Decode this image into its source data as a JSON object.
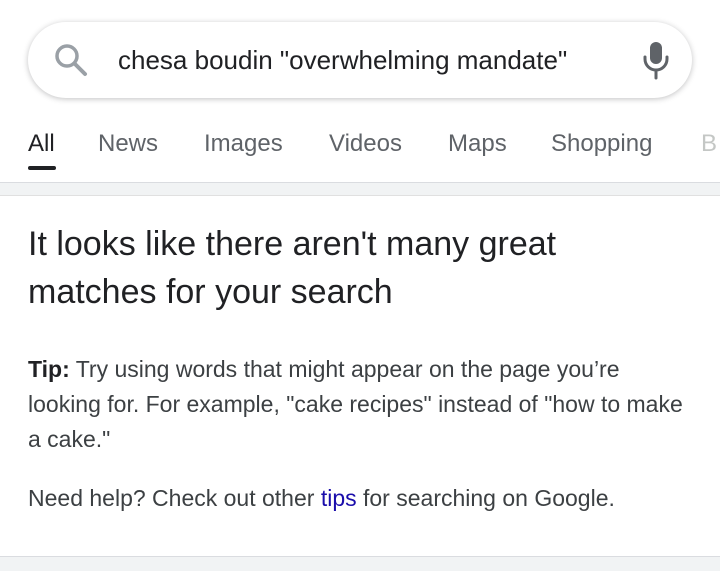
{
  "search": {
    "query": "chesa boudin \"overwhelming mandate\""
  },
  "tabs": [
    {
      "label": "All"
    },
    {
      "label": "News"
    },
    {
      "label": "Images"
    },
    {
      "label": "Videos"
    },
    {
      "label": "Maps"
    },
    {
      "label": "Shopping"
    },
    {
      "label": "B"
    }
  ],
  "result": {
    "headline": "It looks like there aren't many great matches for your search",
    "tip_label": "Tip:",
    "tip_text": " Try using words that might appear on the page you’re looking for. For example, \"cake recipes\" instead of \"how to make a cake.\"",
    "help_prefix": "Need help? Check out other ",
    "help_link": "tips",
    "help_suffix": " for searching on Google."
  },
  "icons": {
    "search": "search-icon",
    "mic": "mic-icon"
  },
  "colors": {
    "link": "#1a0dab",
    "active_tab": "#202124",
    "inactive_tab": "#5f6368"
  }
}
